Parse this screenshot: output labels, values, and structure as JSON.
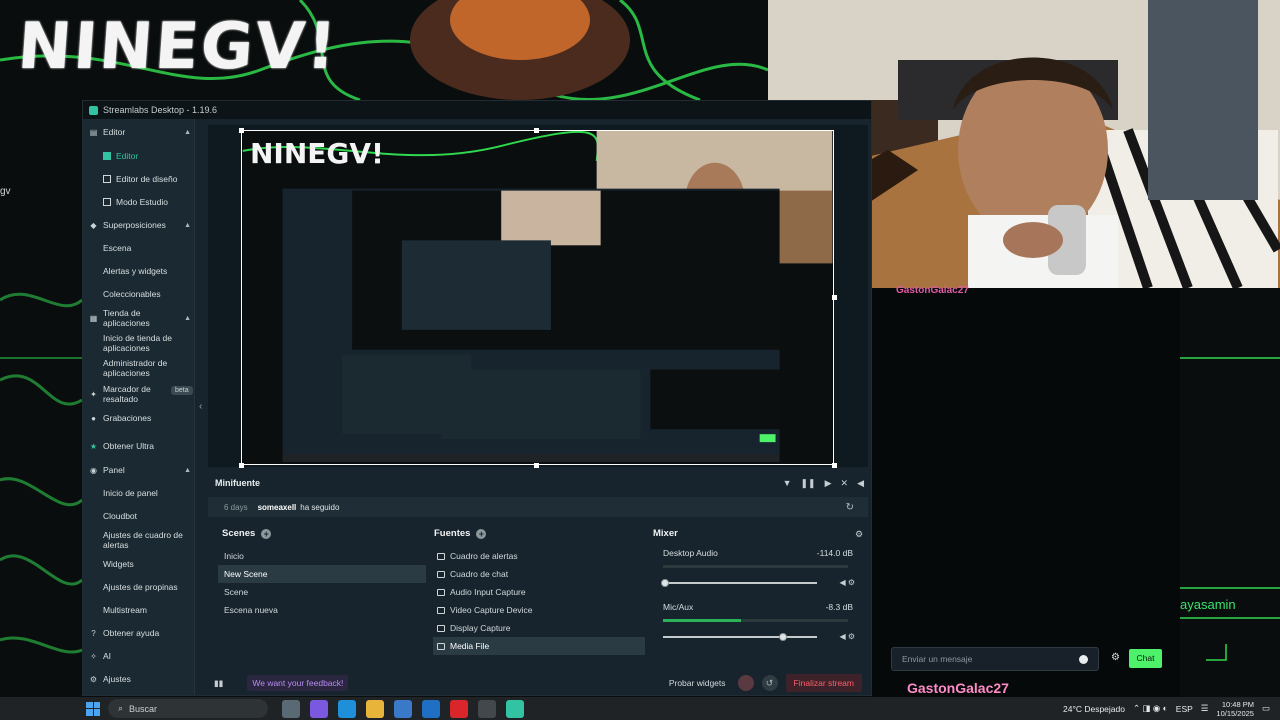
{
  "overlay": {
    "brand_title": "NINEGV!",
    "edge_label": "gv",
    "cam_chat_user": "GastonGalac27"
  },
  "window": {
    "title": "Streamlabs Desktop - 1.19.6"
  },
  "sidebar": {
    "groups": [
      {
        "label": "Editor",
        "icon": "editor-icon",
        "items": [
          "Editor",
          "Editor de diseño",
          "Modo Estudio"
        ]
      },
      {
        "label": "Superposiciones",
        "icon": "overlays-icon",
        "items": [
          "Escena",
          "Alertas y widgets",
          "Coleccionables"
        ]
      },
      {
        "label": "Tienda de aplicaciones",
        "icon": "store-icon",
        "items": [
          "Inicio de tienda de aplicaciones",
          "Administrador de aplicaciones"
        ]
      }
    ],
    "marcador": "Marcador de resaltado",
    "beta": "beta",
    "grabaciones": "Grabaciones",
    "obtener_ultra": "Obtener Ultra",
    "panel": {
      "label": "Panel",
      "items": [
        "Inicio de panel",
        "Cloudbot",
        "Ajustes de cuadro de alertas",
        "Widgets",
        "Ajustes de propinas",
        "Multistream"
      ]
    },
    "obtener_ayuda": "Obtener ayuda",
    "ai": "AI",
    "ajustes": "Ajustes"
  },
  "minifeed": {
    "title": "Minifuente",
    "event": {
      "time": "6 days",
      "user": "someaxell",
      "action": "ha seguido"
    }
  },
  "scenes": {
    "title": "Scenes",
    "items": [
      "Inicio",
      "New Scene",
      "Scene",
      "Escena nueva"
    ],
    "selected": "New Scene"
  },
  "sources": {
    "title": "Fuentes",
    "items": [
      "Cuadro de alertas",
      "Cuadro de chat",
      "Audio Input Capture",
      "Video Capture Device",
      "Display Capture",
      "Media File"
    ],
    "selected": "Media File"
  },
  "mixer": {
    "title": "Mixer",
    "channels": [
      {
        "name": "Desktop Audio",
        "db": "-114.0 dB",
        "level": 0.0,
        "volume": 0.02
      },
      {
        "name": "Mic/Aux",
        "db": "-8.3 dB",
        "level": 0.42,
        "volume": 0.78
      }
    ]
  },
  "footer": {
    "feedback": "We want your feedback!",
    "probar": "Probar widgets",
    "finalizar": "Finalizar stream"
  },
  "chat": {
    "placeholder": "Enviar un mensaje",
    "button": "Chat",
    "user": "GastonGalac27",
    "side_text": "ayasamin"
  },
  "taskbar": {
    "search": "Buscar",
    "weather": "24°C  Despejado",
    "lang": "ESP",
    "time": "10:48 PM",
    "date": "10/15/2025"
  },
  "colors": {
    "accent": "#31c3a2",
    "green_lines": "#2fd84e",
    "chat_button": "#4ef16a"
  }
}
